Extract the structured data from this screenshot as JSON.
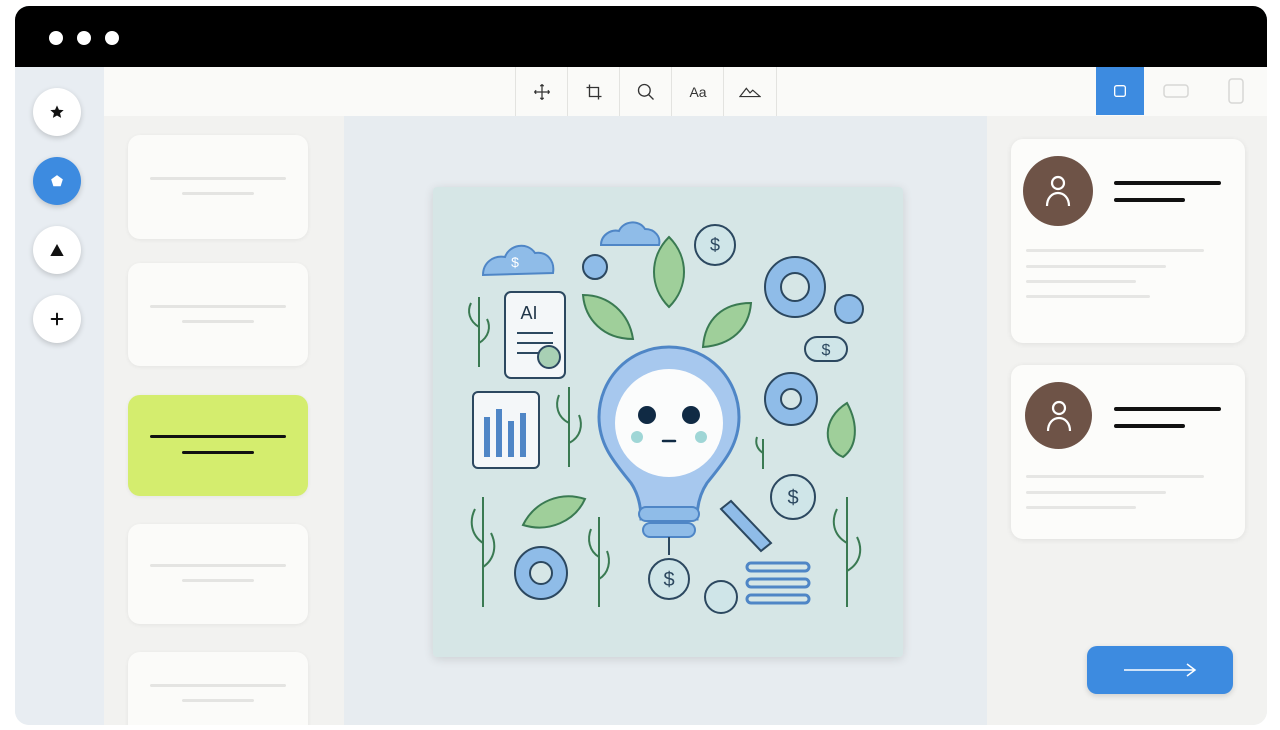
{
  "window": {
    "controls": [
      "window-dot-1",
      "window-dot-2",
      "window-dot-3"
    ]
  },
  "rail": {
    "items": [
      {
        "name": "star-icon",
        "active": false
      },
      {
        "name": "pentagon-icon",
        "active": true
      },
      {
        "name": "triangle-icon",
        "active": false
      },
      {
        "name": "plus-icon",
        "active": false
      }
    ]
  },
  "toolbar": {
    "tools": [
      "move-icon",
      "crop-icon",
      "zoom-icon",
      "text-tool",
      "shape-tool"
    ],
    "text_tool_label": "Aa",
    "views": [
      {
        "name": "view-square-icon",
        "active": true
      },
      {
        "name": "view-landscape-icon",
        "active": false
      },
      {
        "name": "view-portrait-icon",
        "active": false
      }
    ]
  },
  "left_panel": {
    "selected_index": 2,
    "card_count": 5
  },
  "canvas": {
    "image_text": "AI",
    "currency_symbol": "$"
  },
  "right_panel": {
    "profile_cards": 2
  },
  "colors": {
    "accent": "#3d8be0",
    "selected_card": "#d4ed6e",
    "avatar": "#6e5347"
  }
}
